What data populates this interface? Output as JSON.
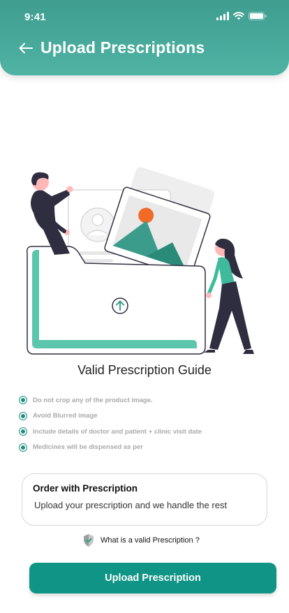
{
  "status_bar": {
    "time": "9:41"
  },
  "header": {
    "title": "Upload Prescriptions"
  },
  "guide": {
    "title": "Valid Prescription Guide",
    "items": [
      {
        "text": "Do not crop any of the product image."
      },
      {
        "text": "Avoid Blurred image"
      },
      {
        "text": "Include details of doctor and patient + clinic visit date"
      },
      {
        "text": "Medicines will be dispensed as per"
      }
    ]
  },
  "order_card": {
    "title": "Order with Prescription",
    "subtitle": "Upload your prescription and we handle the rest"
  },
  "valid_link": {
    "label": "What is a valid Prescription ?"
  },
  "upload_button": {
    "label": "Upload Prescription"
  },
  "colors": {
    "accent": "#109485",
    "header": "#4aa998",
    "illustration_green": "#54c0a8"
  },
  "icons": [
    "back-arrow-icon",
    "signal-icon",
    "wifi-icon",
    "battery-icon",
    "shield-check-icon",
    "upload-icon"
  ]
}
